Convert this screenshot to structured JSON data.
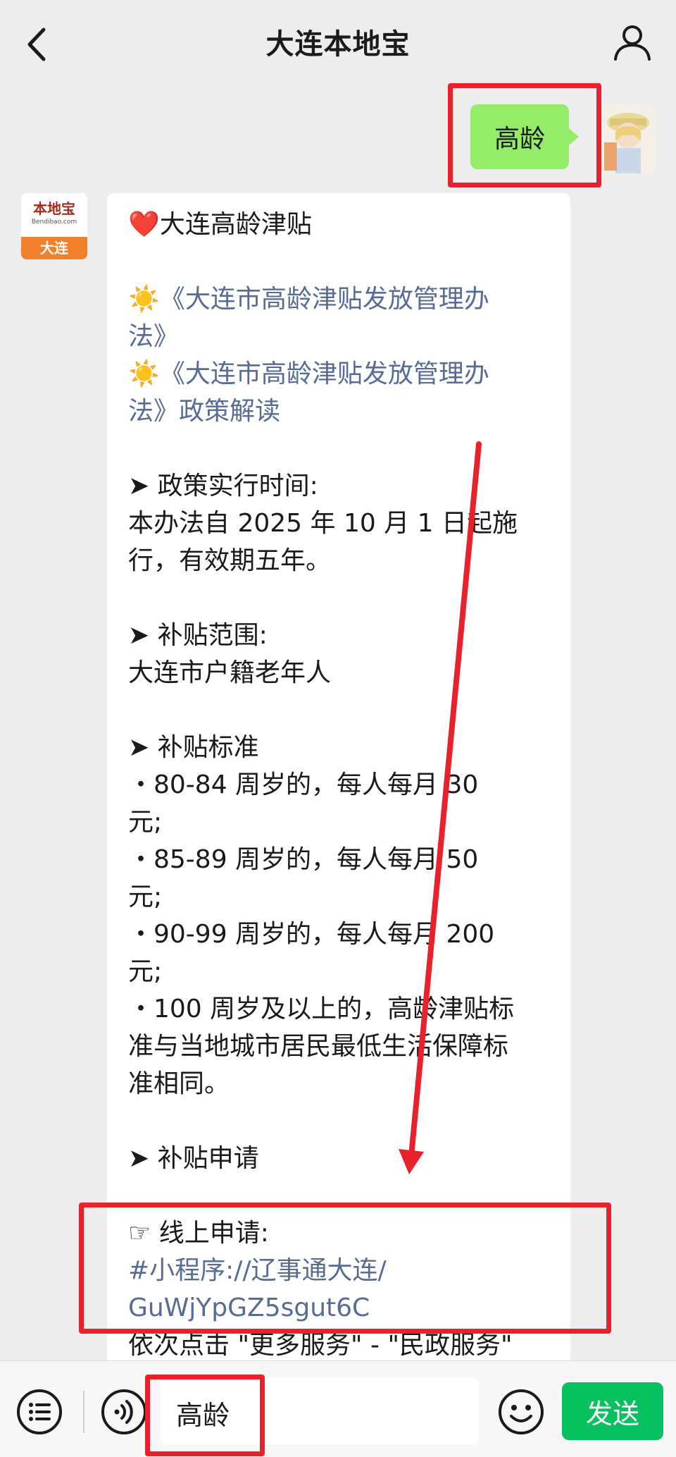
{
  "header": {
    "title": "大连本地宝"
  },
  "outgoing_message": {
    "text": "高龄"
  },
  "bot": {
    "avatar_logo_text": "本地宝",
    "avatar_domain": "Bendibao.com",
    "avatar_city": "大连"
  },
  "incoming_message": {
    "lines": [
      {
        "text": "❤️大连高龄津贴",
        "style": "normal"
      },
      {
        "text": "",
        "style": "blank"
      },
      {
        "text": "☀️《大连市高龄津贴发放管理办",
        "style": "link"
      },
      {
        "text": "法》",
        "style": "link"
      },
      {
        "text": "☀️《大连市高龄津贴发放管理办",
        "style": "link"
      },
      {
        "text": "法》政策解读",
        "style": "link"
      },
      {
        "text": "",
        "style": "blank"
      },
      {
        "text": "➤ 政策实行时间:",
        "style": "normal"
      },
      {
        "text": "本办法自 2025 年 10 月 1 日起施",
        "style": "normal"
      },
      {
        "text": "行，有效期五年。",
        "style": "normal"
      },
      {
        "text": "",
        "style": "blank"
      },
      {
        "text": "➤ 补贴范围:",
        "style": "normal"
      },
      {
        "text": "大连市户籍老年人",
        "style": "normal"
      },
      {
        "text": "",
        "style": "blank"
      },
      {
        "text": "➤ 补贴标准",
        "style": "normal"
      },
      {
        "text": "・80-84 周岁的，每人每月 30",
        "style": "normal"
      },
      {
        "text": "元;",
        "style": "normal"
      },
      {
        "text": "・85-89 周岁的，每人每月 50",
        "style": "normal"
      },
      {
        "text": "元;",
        "style": "normal"
      },
      {
        "text": "・90-99 周岁的，每人每月 200",
        "style": "normal"
      },
      {
        "text": "元;",
        "style": "normal"
      },
      {
        "text": "・100 周岁及以上的，高龄津贴标",
        "style": "normal"
      },
      {
        "text": "准与当地城市居民最低生活保障标",
        "style": "normal"
      },
      {
        "text": "准相同。",
        "style": "normal"
      },
      {
        "text": "",
        "style": "blank"
      },
      {
        "text": "➤ 补贴申请",
        "style": "normal"
      },
      {
        "text": "",
        "style": "blank"
      },
      {
        "text": "☞ 线上申请:",
        "style": "normal"
      },
      {
        "text": "#小程序://辽事通大连/",
        "style": "link"
      },
      {
        "text": "GuWjYpGZ5sgut6C",
        "style": "link"
      },
      {
        "text": "依次点击 \"更多服务\" - \"民政服务\"",
        "style": "normal"
      }
    ]
  },
  "input": {
    "value": "高龄"
  },
  "send_button": {
    "label": "发送"
  },
  "colors": {
    "background": "#ededed",
    "outgoing_bubble": "#95ec69",
    "link": "#576b95",
    "send_button": "#07c160",
    "annotation_red": "#e8212a"
  },
  "icons": [
    "back-arrow-icon",
    "user-profile-icon",
    "menu-list-icon",
    "voice-icon",
    "emoji-icon"
  ]
}
